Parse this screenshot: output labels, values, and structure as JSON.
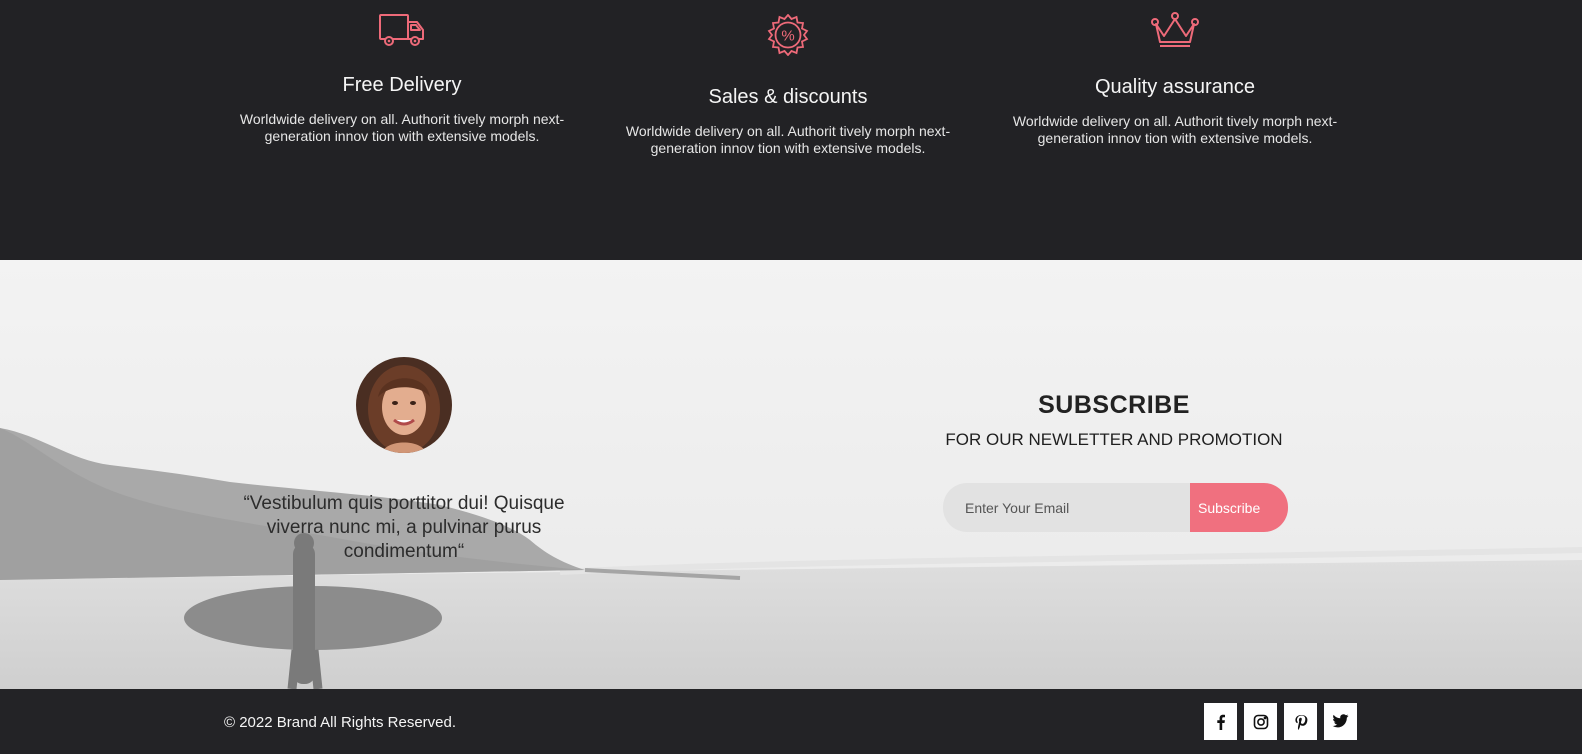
{
  "features": [
    {
      "icon": "delivery-truck-icon",
      "title": "Free Delivery",
      "text": "Worldwide delivery on all. Authorit tively morph next-generation innov tion with extensive models."
    },
    {
      "icon": "discount-badge-icon",
      "title": "Sales & discounts",
      "text": "Worldwide delivery on all. Authorit tively morph next-generation innov tion with extensive models."
    },
    {
      "icon": "crown-icon",
      "title": "Quality assurance",
      "text": "Worldwide delivery on all. Authorit tively morph next-generation innov tion with extensive models."
    }
  ],
  "testimonial": {
    "quote": "“Vestibulum quis porttitor dui! Quisque viverra nunc mi, a pulvinar purus condimentum“"
  },
  "subscribe": {
    "title": "SUBSCRIBE",
    "tagline": "FOR OUR NEWLETTER AND PROMOTION",
    "placeholder": "Enter Your Email",
    "button": "Subscribe"
  },
  "footer": {
    "copyright": "© 2022 Brand All Rights Reserved.",
    "social": [
      "facebook-icon",
      "instagram-icon",
      "pinterest-icon",
      "twitter-icon"
    ]
  },
  "colors": {
    "accent": "#f0707f",
    "dark_bg": "#222225",
    "light_bg": "#efefef"
  }
}
